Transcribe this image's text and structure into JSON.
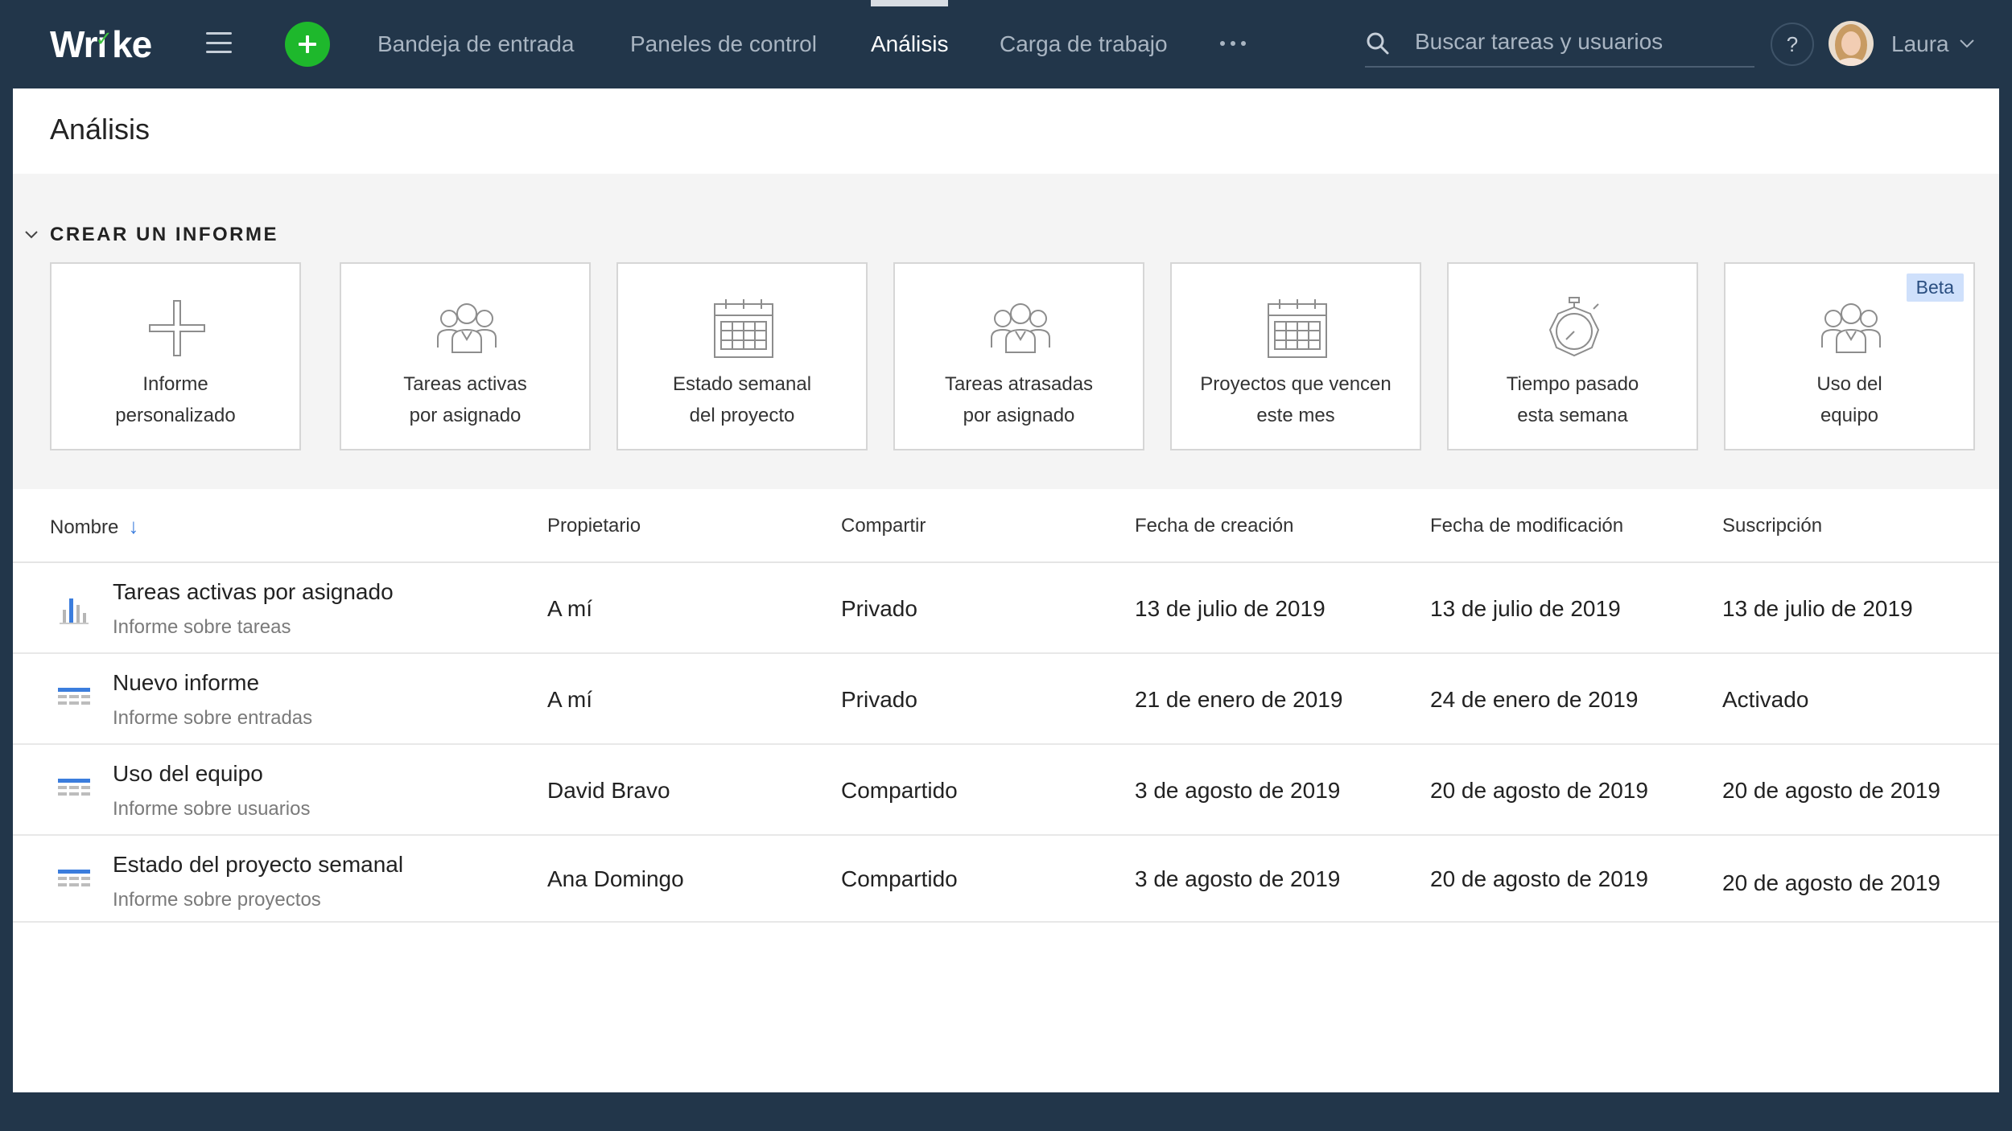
{
  "app": {
    "logo_text_a": "Wr",
    "logo_text_b": "ke",
    "accent_color": "#1eb82c",
    "link_color": "#3b7ddd"
  },
  "nav": {
    "tabs": [
      {
        "label": "Bandeja de entrada",
        "active": false
      },
      {
        "label": "Paneles de control",
        "active": false
      },
      {
        "label": "Análisis",
        "active": true
      },
      {
        "label": "Carga de trabajo",
        "active": false
      }
    ],
    "more_icon": "ellipsis-icon"
  },
  "search": {
    "placeholder": "Buscar tareas y usuarios",
    "value": ""
  },
  "help": {
    "label": "?"
  },
  "user": {
    "name": "Laura"
  },
  "page": {
    "title": "Análisis"
  },
  "create_report": {
    "section_label": "CREAR UN INFORME",
    "cards": [
      {
        "label": "Informe\npersonalizado",
        "icon": "plus-icon"
      },
      {
        "label": "Tareas activas\npor asignado",
        "icon": "team-icon"
      },
      {
        "label": "Estado semanal\ndel proyecto",
        "icon": "calendar-icon"
      },
      {
        "label": "Tareas atrasadas\npor asignado",
        "icon": "team-icon"
      },
      {
        "label": "Proyectos que vencen\neste mes",
        "icon": "calendar-icon"
      },
      {
        "label": "Tiempo pasado\nesta semana",
        "icon": "stopwatch-icon"
      },
      {
        "label": "Uso del\nequipo",
        "icon": "team-icon",
        "badge": "Beta"
      }
    ]
  },
  "table": {
    "columns": [
      "Nombre",
      "Propietario",
      "Compartir",
      "Fecha de creación",
      "Fecha de modificación",
      "Suscripción"
    ],
    "sort_indicator": "↓",
    "rows": [
      {
        "icon": "bar-chart-icon",
        "name": "Tareas activas por asignado",
        "type": "Informe sobre tareas",
        "owner": "A mí",
        "share": "Privado",
        "created": "13 de julio de 2019",
        "modified": "13 de julio de 2019",
        "subscription": "13 de julio de 2019"
      },
      {
        "icon": "table-icon",
        "name": "Nuevo informe",
        "type": "Informe sobre entradas",
        "owner": "A mí",
        "share": "Privado",
        "created": "21 de enero de 2019",
        "modified": "24 de enero de 2019",
        "subscription": "Activado"
      },
      {
        "icon": "table-icon",
        "name": "Uso del equipo",
        "type": "Informe sobre usuarios",
        "owner": "David Bravo",
        "share": "Compartido",
        "created": "3 de agosto de 2019",
        "modified": "20 de agosto de 2019",
        "subscription": "20 de agosto de 2019"
      },
      {
        "icon": "table-icon",
        "name": "Estado del proyecto semanal",
        "type": "Informe sobre proyectos",
        "owner": "Ana Domingo",
        "share": "Compartido",
        "created": "3 de agosto de 2019",
        "modified": "20 de agosto de 2019",
        "subscription": "20 de agosto de 2019"
      }
    ]
  }
}
